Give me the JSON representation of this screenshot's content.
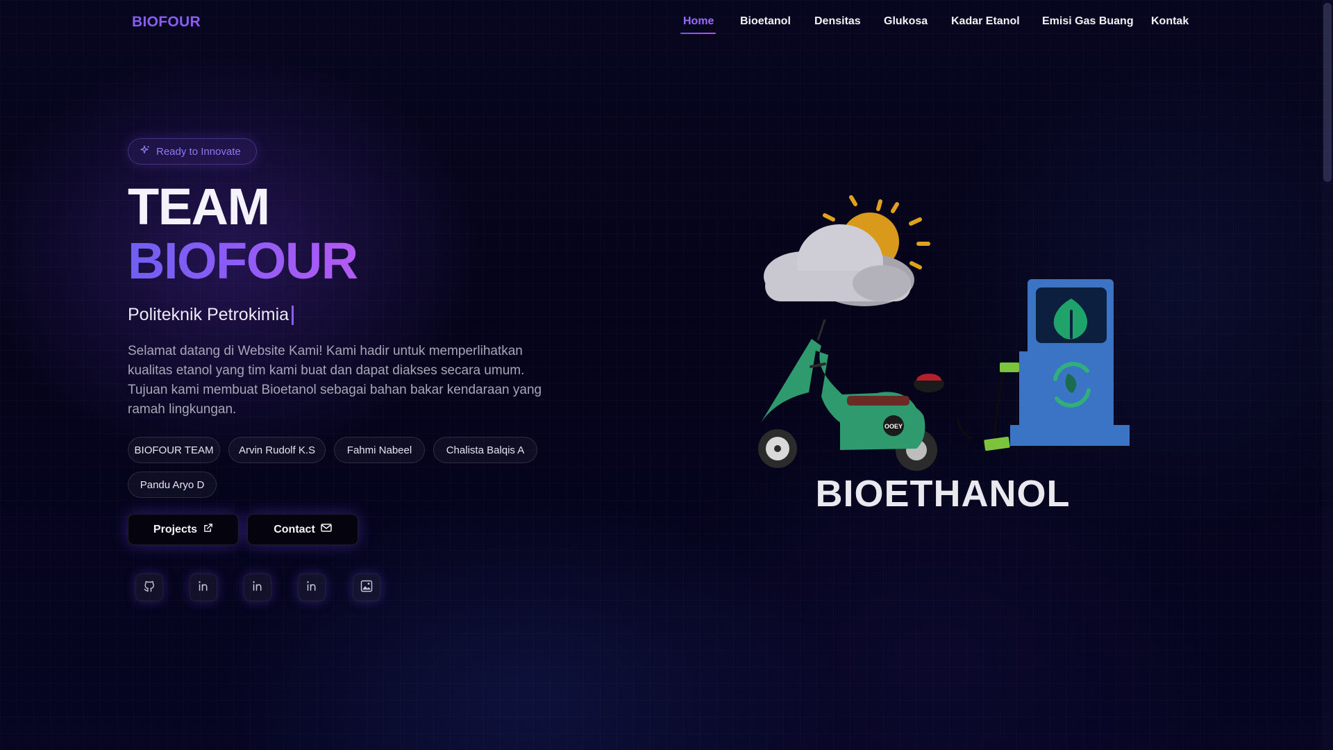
{
  "header": {
    "brand": "BIOFOUR",
    "nav": [
      "Home",
      "Bioetanol",
      "Densitas",
      "Glukosa",
      "Kadar Etanol",
      "Emisi Gas Buang",
      "Kontak"
    ],
    "active": "Home"
  },
  "hero": {
    "badge": "Ready to Innovate",
    "title_line1": "TEAM",
    "title_line2": "BIOFOUR",
    "subtitle": "Politeknik Petrokimia",
    "description": "Selamat datang di Website Kami! Kami hadir untuk memperlihatkan kualitas etanol yang tim kami buat dan dapat diakses secara umum. Tujuan kami membuat Bioetanol sebagai bahan bakar kendaraan yang ramah lingkungan.",
    "chips": [
      "BIOFOUR TEAM",
      "Arvin Rudolf K.S",
      "Fahmi Nabeel",
      "Chalista Balqis A",
      "Pandu Aryo D"
    ],
    "buttons": {
      "projects": "Projects",
      "contact": "Contact"
    },
    "socials": [
      "github-icon",
      "linkedin-icon",
      "linkedin-icon",
      "linkedin-icon",
      "image-icon"
    ]
  },
  "illustration": {
    "caption": "BIOETHANOL",
    "scooter_badge": "OOEY"
  },
  "colors": {
    "accent": "#8b5cf6",
    "background": "#05041a",
    "pump": "#3b74c4",
    "leaf": "#1fa36a",
    "scooter": "#2f9a6e",
    "sun": "#e0a11c"
  }
}
